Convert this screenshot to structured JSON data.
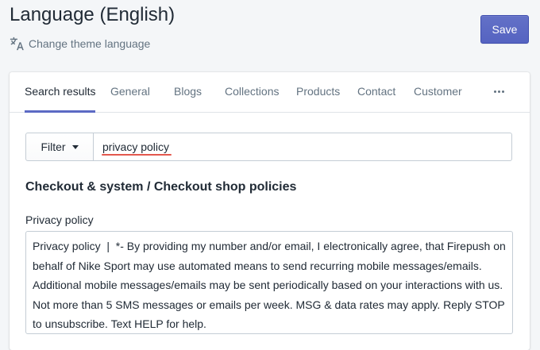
{
  "header": {
    "title": "Language (English)",
    "change_language_label": "Change theme language",
    "change_language_icon": "translate-icon",
    "save_label": "Save",
    "accent_color": "#5c6ac4"
  },
  "tabs": [
    {
      "label": "Search results",
      "active": true
    },
    {
      "label": "General",
      "active": false
    },
    {
      "label": "Blogs",
      "active": false
    },
    {
      "label": "Collections",
      "active": false
    },
    {
      "label": "Products",
      "active": false
    },
    {
      "label": "Contact",
      "active": false
    },
    {
      "label": "Customer",
      "active": false
    }
  ],
  "more_tab_icon": "more-horizontal-icon",
  "filter": {
    "button_label": "Filter",
    "button_icon": "caret-down-icon",
    "search_value": "privacy policy"
  },
  "section": {
    "heading": "Checkout & system / Checkout shop policies",
    "field_label": "Privacy policy",
    "field_value": "Privacy policy  |  *- By providing my number and/or email, I electronically agree, that Firepush on behalf of Nike Sport may use automated means to send recurring mobile messages/emails. Additional mobile messages/emails may be sent periodically based on your interactions with us. Not more than 5 SMS messages or emails per week. MSG & data rates may apply. Reply STOP to unsubscribe. Text HELP for help."
  }
}
